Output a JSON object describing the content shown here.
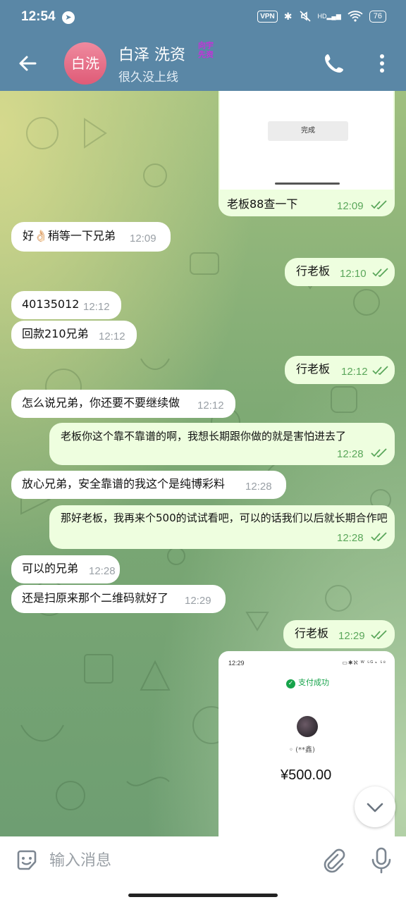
{
  "status_bar": {
    "time": "12:54",
    "vpn": "VPN",
    "network": "HD",
    "battery": "76"
  },
  "header": {
    "avatar_text": "白洗",
    "title": "白泽 洗资",
    "title_decoration": "向宇 先资",
    "subtitle": "很久没上线"
  },
  "messages": [
    {
      "dir": "out",
      "text": "老板88查一下",
      "time": "12:09",
      "image_button": "完成"
    },
    {
      "dir": "in",
      "text": "好👌🏻稍等一下兄弟",
      "time": "12:09"
    },
    {
      "dir": "out",
      "text": "行老板",
      "time": "12:10"
    },
    {
      "dir": "in",
      "text": "40135012",
      "time": "12:12"
    },
    {
      "dir": "in",
      "text": "回款210兄弟",
      "time": "12:12"
    },
    {
      "dir": "out",
      "text": "行老板",
      "time": "12:12"
    },
    {
      "dir": "in",
      "text": "怎么说兄弟，你还要不要继续做",
      "time": "12:12"
    },
    {
      "dir": "out",
      "text": "老板你这个靠不靠谱的啊，我想长期跟你做的就是害怕进去了",
      "time": "12:28"
    },
    {
      "dir": "in",
      "text": "放心兄弟，安全靠谱的我这个是纯博彩料",
      "time": "12:28"
    },
    {
      "dir": "out",
      "text": "那好老板，我再来个500的试试看吧，可以的话我们以后就长期合作吧",
      "time": "12:28"
    },
    {
      "dir": "in",
      "text": "可以的兄弟",
      "time": "12:28"
    },
    {
      "dir": "in",
      "text": "还是扫原来那个二维码就好了",
      "time": "12:29"
    },
    {
      "dir": "out",
      "text": "行老板",
      "time": "12:29"
    }
  ],
  "payment_screenshot": {
    "status_time": "12:29",
    "status_icons": "▭✱ℵ ᵂ ⁵ᴳ◔ ⁵⁸",
    "success_text": "支付成功",
    "payee": "(**鑫)",
    "amount": "¥500.00"
  },
  "input": {
    "placeholder": "输入消息"
  },
  "colors": {
    "header": "#5a87a6",
    "incoming_bubble": "#ffffff",
    "outgoing_bubble": "#eefedf",
    "outgoing_time": "#5ba75b",
    "avatar": "#e46b85"
  },
  "icons": {
    "back": "arrow-left-icon",
    "call": "phone-icon",
    "menu": "more-vertical-icon",
    "emoji": "sticker-icon",
    "attach": "paperclip-icon",
    "mic": "microphone-icon",
    "scroll": "chevron-down-icon",
    "read": "double-check-icon"
  }
}
